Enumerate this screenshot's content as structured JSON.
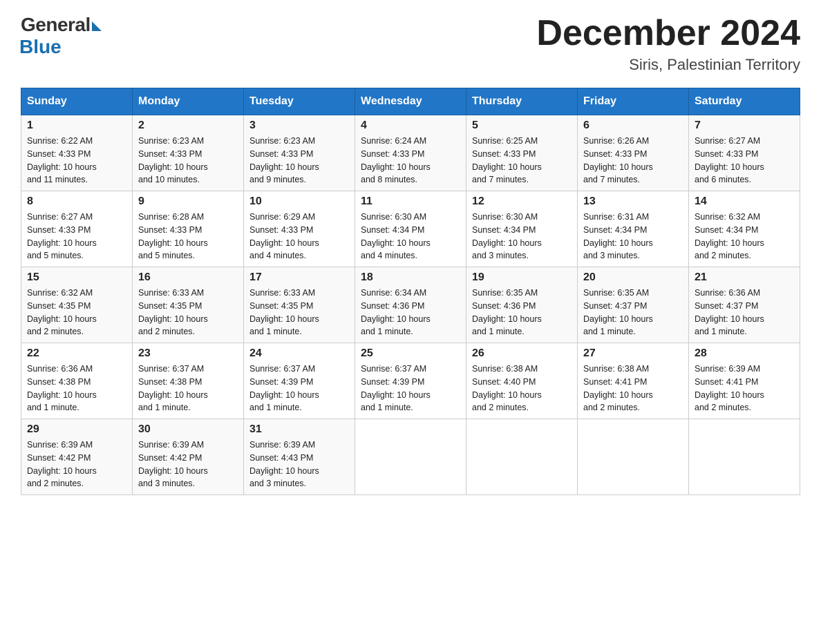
{
  "header": {
    "logo_general": "General",
    "logo_blue": "Blue",
    "month_title": "December 2024",
    "location": "Siris, Palestinian Territory"
  },
  "days_of_week": [
    "Sunday",
    "Monday",
    "Tuesday",
    "Wednesday",
    "Thursday",
    "Friday",
    "Saturday"
  ],
  "weeks": [
    [
      {
        "day": "1",
        "sunrise": "6:22 AM",
        "sunset": "4:33 PM",
        "daylight": "10 hours and 11 minutes."
      },
      {
        "day": "2",
        "sunrise": "6:23 AM",
        "sunset": "4:33 PM",
        "daylight": "10 hours and 10 minutes."
      },
      {
        "day": "3",
        "sunrise": "6:23 AM",
        "sunset": "4:33 PM",
        "daylight": "10 hours and 9 minutes."
      },
      {
        "day": "4",
        "sunrise": "6:24 AM",
        "sunset": "4:33 PM",
        "daylight": "10 hours and 8 minutes."
      },
      {
        "day": "5",
        "sunrise": "6:25 AM",
        "sunset": "4:33 PM",
        "daylight": "10 hours and 7 minutes."
      },
      {
        "day": "6",
        "sunrise": "6:26 AM",
        "sunset": "4:33 PM",
        "daylight": "10 hours and 7 minutes."
      },
      {
        "day": "7",
        "sunrise": "6:27 AM",
        "sunset": "4:33 PM",
        "daylight": "10 hours and 6 minutes."
      }
    ],
    [
      {
        "day": "8",
        "sunrise": "6:27 AM",
        "sunset": "4:33 PM",
        "daylight": "10 hours and 5 minutes."
      },
      {
        "day": "9",
        "sunrise": "6:28 AM",
        "sunset": "4:33 PM",
        "daylight": "10 hours and 5 minutes."
      },
      {
        "day": "10",
        "sunrise": "6:29 AM",
        "sunset": "4:33 PM",
        "daylight": "10 hours and 4 minutes."
      },
      {
        "day": "11",
        "sunrise": "6:30 AM",
        "sunset": "4:34 PM",
        "daylight": "10 hours and 4 minutes."
      },
      {
        "day": "12",
        "sunrise": "6:30 AM",
        "sunset": "4:34 PM",
        "daylight": "10 hours and 3 minutes."
      },
      {
        "day": "13",
        "sunrise": "6:31 AM",
        "sunset": "4:34 PM",
        "daylight": "10 hours and 3 minutes."
      },
      {
        "day": "14",
        "sunrise": "6:32 AM",
        "sunset": "4:34 PM",
        "daylight": "10 hours and 2 minutes."
      }
    ],
    [
      {
        "day": "15",
        "sunrise": "6:32 AM",
        "sunset": "4:35 PM",
        "daylight": "10 hours and 2 minutes."
      },
      {
        "day": "16",
        "sunrise": "6:33 AM",
        "sunset": "4:35 PM",
        "daylight": "10 hours and 2 minutes."
      },
      {
        "day": "17",
        "sunrise": "6:33 AM",
        "sunset": "4:35 PM",
        "daylight": "10 hours and 1 minute."
      },
      {
        "day": "18",
        "sunrise": "6:34 AM",
        "sunset": "4:36 PM",
        "daylight": "10 hours and 1 minute."
      },
      {
        "day": "19",
        "sunrise": "6:35 AM",
        "sunset": "4:36 PM",
        "daylight": "10 hours and 1 minute."
      },
      {
        "day": "20",
        "sunrise": "6:35 AM",
        "sunset": "4:37 PM",
        "daylight": "10 hours and 1 minute."
      },
      {
        "day": "21",
        "sunrise": "6:36 AM",
        "sunset": "4:37 PM",
        "daylight": "10 hours and 1 minute."
      }
    ],
    [
      {
        "day": "22",
        "sunrise": "6:36 AM",
        "sunset": "4:38 PM",
        "daylight": "10 hours and 1 minute."
      },
      {
        "day": "23",
        "sunrise": "6:37 AM",
        "sunset": "4:38 PM",
        "daylight": "10 hours and 1 minute."
      },
      {
        "day": "24",
        "sunrise": "6:37 AM",
        "sunset": "4:39 PM",
        "daylight": "10 hours and 1 minute."
      },
      {
        "day": "25",
        "sunrise": "6:37 AM",
        "sunset": "4:39 PM",
        "daylight": "10 hours and 1 minute."
      },
      {
        "day": "26",
        "sunrise": "6:38 AM",
        "sunset": "4:40 PM",
        "daylight": "10 hours and 2 minutes."
      },
      {
        "day": "27",
        "sunrise": "6:38 AM",
        "sunset": "4:41 PM",
        "daylight": "10 hours and 2 minutes."
      },
      {
        "day": "28",
        "sunrise": "6:39 AM",
        "sunset": "4:41 PM",
        "daylight": "10 hours and 2 minutes."
      }
    ],
    [
      {
        "day": "29",
        "sunrise": "6:39 AM",
        "sunset": "4:42 PM",
        "daylight": "10 hours and 2 minutes."
      },
      {
        "day": "30",
        "sunrise": "6:39 AM",
        "sunset": "4:42 PM",
        "daylight": "10 hours and 3 minutes."
      },
      {
        "day": "31",
        "sunrise": "6:39 AM",
        "sunset": "4:43 PM",
        "daylight": "10 hours and 3 minutes."
      },
      null,
      null,
      null,
      null
    ]
  ],
  "labels": {
    "sunrise": "Sunrise:",
    "sunset": "Sunset:",
    "daylight": "Daylight:"
  }
}
